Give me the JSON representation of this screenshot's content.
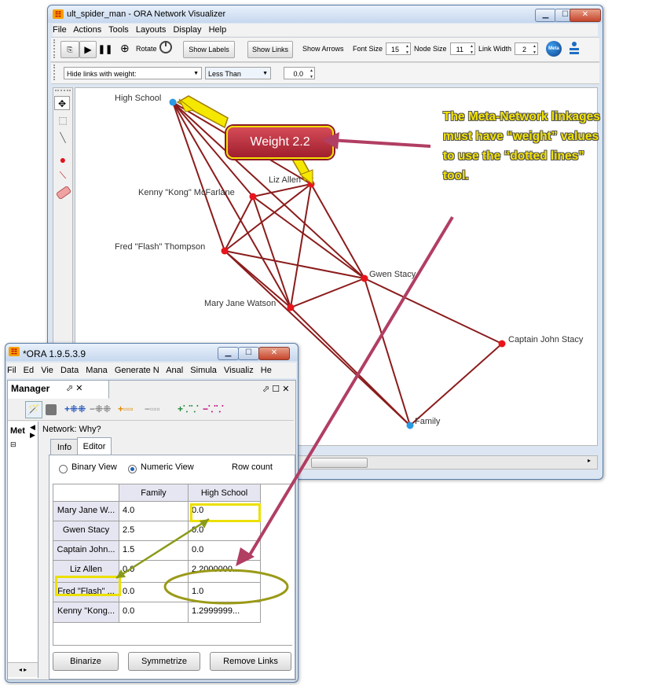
{
  "visualizer": {
    "title": "ult_spider_man - ORA Network Visualizer",
    "menu": [
      "File",
      "Actions",
      "Tools",
      "Layouts",
      "Display",
      "Help"
    ],
    "toolbar": {
      "rotate_label": "Rotate",
      "show_labels": "Show Labels",
      "show_links": "Show Links",
      "show_arrows": "Show Arrows",
      "font_size_label": "Font Size",
      "font_size": "15",
      "node_size_label": "Node Size",
      "node_size": "11",
      "link_width_label": "Link Width",
      "link_width": "2",
      "meta_label": "Meta"
    },
    "filter": {
      "hide_links": "Hide links with weight:",
      "comparator": "Less Than",
      "value": "0.0"
    },
    "network": {
      "node_color": "#e8141b",
      "meta_node_color": "#2a9ae4",
      "link_color": "#8b1c1c",
      "nodes": [
        {
          "label": "High School"
        },
        {
          "label": "Liz Allen"
        },
        {
          "label": "Kenny \"Kong\" McFarlane"
        },
        {
          "label": "Fred \"Flash\" Thompson"
        },
        {
          "label": "Gwen Stacy"
        },
        {
          "label": "Mary Jane Watson"
        },
        {
          "label": "Captain John Stacy"
        },
        {
          "label": "Family"
        }
      ]
    }
  },
  "annotations": {
    "weight_badge": "Weight 2.2",
    "callout_lines": [
      "The Meta-Network linkages",
      "must have “weight” values",
      "to use the “dotted lines”",
      "tool."
    ],
    "callout_color": "#f5e400",
    "arrow_color": "#b13e63"
  },
  "ora": {
    "title": "*ORA 1.9.5.3.9",
    "menu": [
      "Fil",
      "Ed",
      "Vie",
      "Data",
      "Mana",
      "Generate N",
      "Anal",
      "Simula",
      "Visualiz",
      "He"
    ],
    "manager_title": "Manager",
    "pin_close": "⬀ ✕",
    "right_controls": "⬀ ☐ ✕",
    "side_label": "Met",
    "network_title": "Network: Why?",
    "tabs": [
      "Info",
      "Editor"
    ],
    "binary_view": "Binary View",
    "numeric_view": "Numeric View",
    "row_count": "Row count",
    "columns": [
      "Family",
      "High School"
    ],
    "rows": [
      {
        "name": "Mary Jane W...",
        "family": "4.0",
        "high_school": "0.0"
      },
      {
        "name": "Gwen Stacy",
        "family": "2.5",
        "high_school": "0.0"
      },
      {
        "name": "Captain John...",
        "family": "1.5",
        "high_school": "0.0"
      },
      {
        "name": "Liz Allen",
        "family": "0.0",
        "high_school": "2.2000000..."
      },
      {
        "name": "Fred \"Flash\" ...",
        "family": "0.0",
        "high_school": "1.0"
      },
      {
        "name": "Kenny \"Kong...",
        "family": "0.0",
        "high_school": "1.2999999..."
      }
    ],
    "buttons": {
      "binarize": "Binarize",
      "symmetrize": "Symmetrize",
      "remove_links": "Remove Links"
    }
  }
}
